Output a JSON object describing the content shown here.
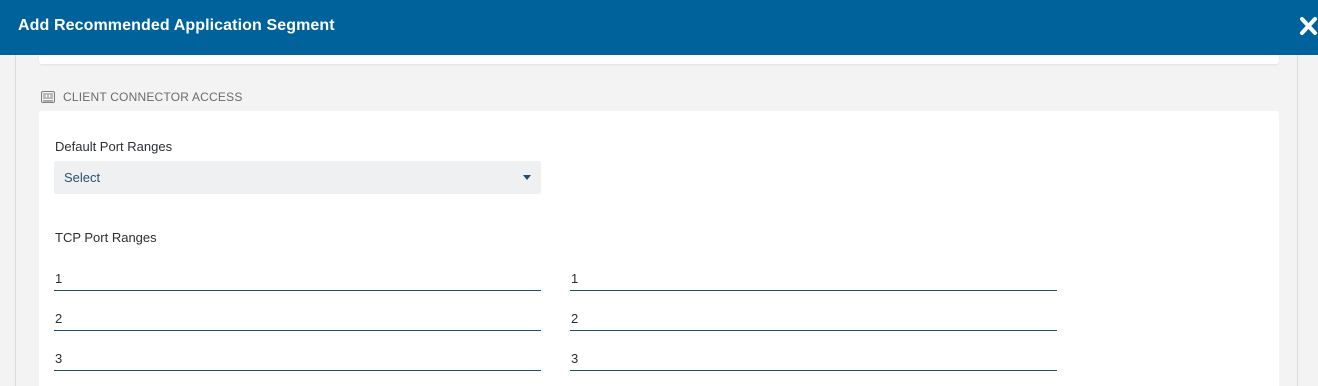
{
  "modal": {
    "title": "Add Recommended Application Segment",
    "close_icon": "close-icon"
  },
  "section": {
    "icon": "client-connector-icon",
    "heading": "CLIENT CONNECTOR ACCESS"
  },
  "default_port_ranges": {
    "label": "Default Port Ranges",
    "selected": "Select",
    "caret_icon": "caret-down-icon"
  },
  "tcp_port_ranges": {
    "label": "TCP Port Ranges",
    "rows": [
      {
        "from": "1",
        "to": "1"
      },
      {
        "from": "2",
        "to": "2"
      },
      {
        "from": "3",
        "to": "3"
      }
    ]
  },
  "colors": {
    "header_bg": "#00629b",
    "accent_line": "#1e4d78"
  }
}
